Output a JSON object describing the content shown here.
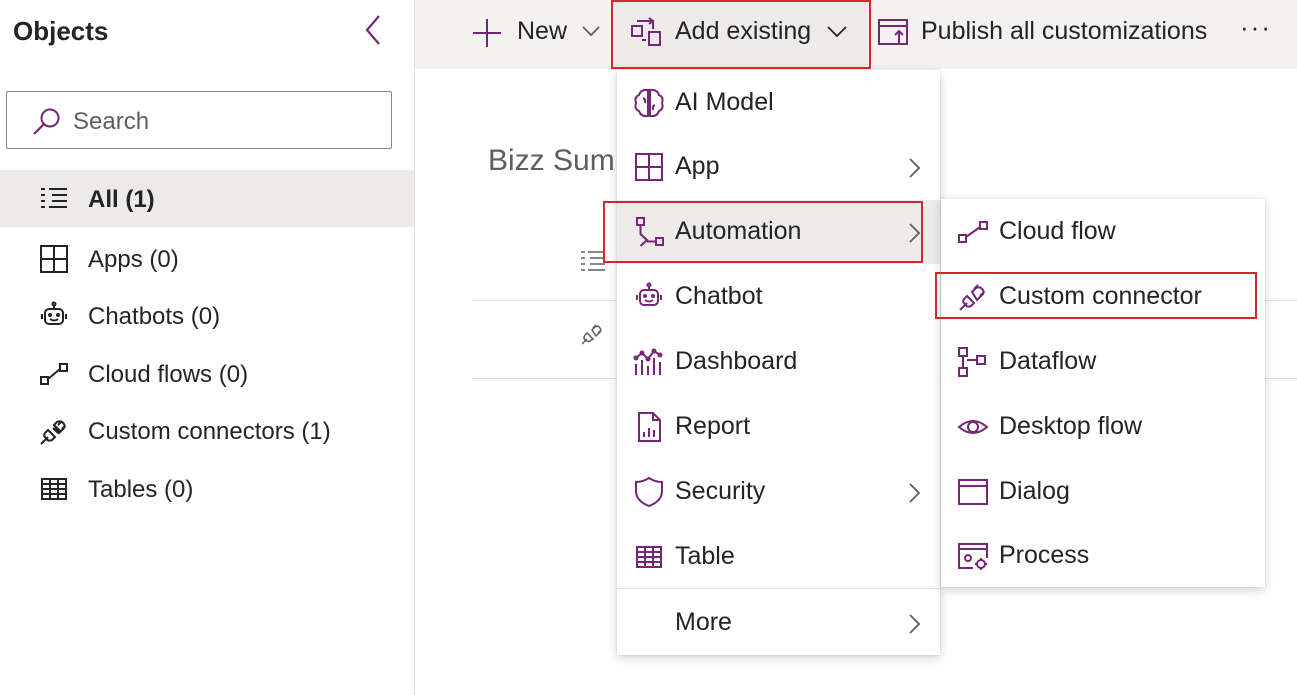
{
  "sidebar": {
    "title": "Objects",
    "search_placeholder": "Search",
    "items": [
      {
        "label": "All  (1)",
        "icon": "list-icon",
        "active": true
      },
      {
        "label": "Apps  (0)",
        "icon": "apps-icon"
      },
      {
        "label": "Chatbots  (0)",
        "icon": "chatbot-icon"
      },
      {
        "label": "Cloud flows  (0)",
        "icon": "cloud-flow-icon"
      },
      {
        "label": "Custom connectors  (1)",
        "icon": "connector-icon"
      },
      {
        "label": "Tables  (0)",
        "icon": "table-icon"
      }
    ]
  },
  "toolbar": {
    "new_label": "New",
    "add_existing_label": "Add existing",
    "publish_label": "Publish all customizations",
    "more_label": "···"
  },
  "main": {
    "title": "Bizz Sum"
  },
  "add_existing_menu": {
    "items": [
      {
        "label": "AI Model",
        "icon": "ai-model-icon"
      },
      {
        "label": "App",
        "icon": "app-icon",
        "submenu": true
      },
      {
        "label": "Automation",
        "icon": "automation-icon",
        "submenu": true,
        "highlighted": true
      },
      {
        "label": "Chatbot",
        "icon": "chatbot-icon"
      },
      {
        "label": "Dashboard",
        "icon": "dashboard-icon"
      },
      {
        "label": "Report",
        "icon": "report-icon"
      },
      {
        "label": "Security",
        "icon": "security-icon",
        "submenu": true
      },
      {
        "label": "Table",
        "icon": "table-icon"
      },
      {
        "label": "More",
        "submenu": true
      }
    ]
  },
  "automation_menu": {
    "items": [
      {
        "label": "Cloud flow",
        "icon": "cloud-flow-icon"
      },
      {
        "label": "Custom connector",
        "icon": "connector-icon",
        "highlighted": true
      },
      {
        "label": "Dataflow",
        "icon": "dataflow-icon"
      },
      {
        "label": "Desktop flow",
        "icon": "desktop-flow-icon"
      },
      {
        "label": "Dialog",
        "icon": "dialog-icon"
      },
      {
        "label": "Process",
        "icon": "process-icon"
      }
    ]
  },
  "colors": {
    "accent_purple": "#742774",
    "highlight_red": "#d9232e",
    "hover_gray": "#edebe9",
    "toolbar_bg": "#f3f2f1"
  }
}
